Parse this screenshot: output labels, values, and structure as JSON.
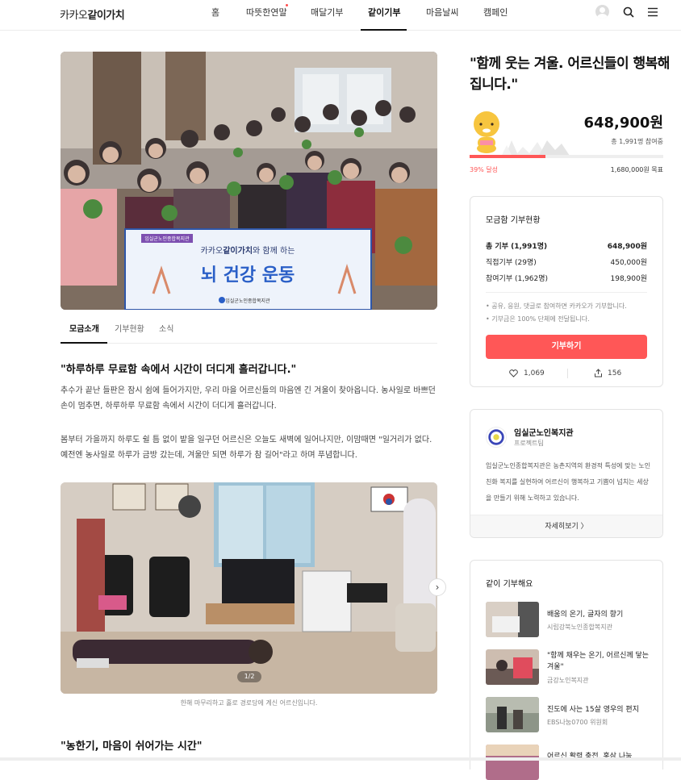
{
  "brand": {
    "prefix": "카카오",
    "name": "같이가치"
  },
  "nav": {
    "items": [
      "홈",
      "따뜻한연말",
      "매달기부",
      "같이기부",
      "마음날씨",
      "캠페인"
    ],
    "active": "같이기부"
  },
  "colors": {
    "accent": "#ff5757",
    "text": "#222222"
  },
  "hero_banner": {
    "top_label": "임실군노인종합복지관",
    "line1_prefix": "카카오",
    "line1_brand": "같이가치",
    "line1_suffix": "와 함께 하는",
    "headline": "뇌 건강 운동",
    "org": "임실군노인종합복지관"
  },
  "tabs": [
    "모금소개",
    "기부현황",
    "소식"
  ],
  "story": {
    "heading1": "\"하루하루 무료함 속에서 시간이 더디게 흘러갑니다.\"",
    "para1": "추수가 끝난 들판은 잠시 쉼에 들어가지만, 우리 마을 어르신들의 마음엔 긴 겨울이 찾아옵니다. 농사일로 바쁘던 손이 멈추면, 하루하루 무료함 속에서 시간이 더디게 흘러갑니다.",
    "para2": "봄부터 가을까지 하루도 쉴 틈 없이 밭을 일구던 어르신은 오늘도 새벽에 일어나지만, 이맘때면 \"일거리가 없다. 예전엔 농사일로 하루가 금방 갔는데, 겨울만 되면 하루가 참 길어\"라고 하며 푸념합니다.",
    "photo_pager": "1/2",
    "photo_caption": "한해 마무리하고 홀로 경로당에 계신 어르신입니다.",
    "heading2": "\"농한기, 마음이 쉬어가는 시간\""
  },
  "campaign": {
    "title": "\"함께 웃는 겨울. 어르신들이 행복해집니다.\"",
    "amount": "648,900원",
    "participants": "총 1,991명 참여중",
    "percent_label": "39% 달성",
    "progress": 0.39,
    "goal": "1,680,000원 목표"
  },
  "status_card": {
    "title": "모금함 기부현황",
    "rows": [
      {
        "label": "총 기부 (1,991명)",
        "value": "648,900원"
      },
      {
        "label": "직접기부 (29명)",
        "value": "450,000원"
      },
      {
        "label": "참여기부 (1,962명)",
        "value": "198,900원"
      }
    ],
    "notes": [
      "• 공유, 응원, 댓글로 참여하면 카카오가 기부합니다.",
      "• 기부금은 100% 단체에 전달됩니다."
    ],
    "donate_label": "기부하기",
    "likes": "1,069",
    "shares": "156"
  },
  "org_card": {
    "name": "임실군노인복지관",
    "type": "프로젝트팀",
    "desc": "임실군노인종합복지관은 농촌지역의 환경적 특성에 맞는 노인 친화 복지를 실현하여 어르신이 행복하고 기쁨이 넘치는 세상을 만들기 위해 노력하고 있습니다.",
    "more_label": "자세히보기 〉"
  },
  "related": {
    "title": "같이 기부해요",
    "items": [
      {
        "title": "배움의 온기, 글자의 향기",
        "org": "시립강북노인종합복지관"
      },
      {
        "title": "\"함께 채우는 온기, 어르신께 닿는 겨울\"",
        "org": "금강노인복지관"
      },
      {
        "title": "진도에 사는 15살 영우의 편지",
        "org": "EBS나눔0700 위원회"
      },
      {
        "title": "어르신 활력 충전, 홍삼 나눔",
        "org": ""
      }
    ]
  }
}
